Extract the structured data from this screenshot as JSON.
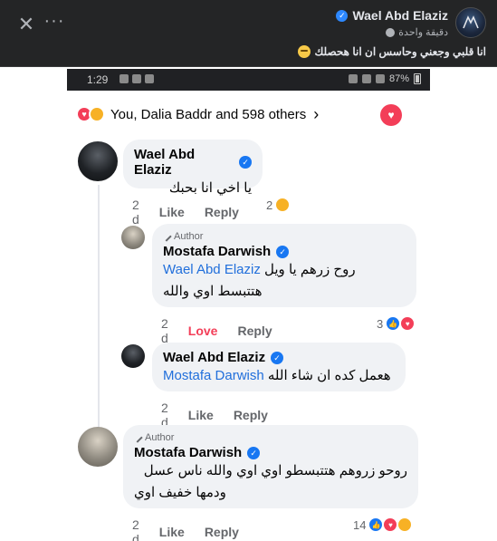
{
  "post": {
    "author": "Wael Abd Elaziz",
    "time": "دقيقة واحدة",
    "caption": "انا قلبي وجعني وحاسس ان انا هحصلك"
  },
  "screenshot": {
    "status_time": "1:29",
    "battery": "87%",
    "reactions_summary": "You, Dalia Baddr and 598 others"
  },
  "comments": [
    {
      "name": "Wael Abd Elaziz",
      "lines": [
        "يا اخي انا بحبك"
      ],
      "time": "2 d",
      "like": "Like",
      "reply": "Reply",
      "reaction_count": "2"
    },
    {
      "author_tag": "Author",
      "name": "Mostafa Darwish",
      "mention": "Wael Abd Elaziz",
      "line1_text": "روح زرهم يا ويل",
      "line2": "هتتبسط اوي والله",
      "time": "2 d",
      "like": "Love",
      "reply": "Reply",
      "reaction_count": "3"
    },
    {
      "name": "Wael Abd Elaziz",
      "mention": "Mostafa Darwish",
      "line1_text": "هعمل كده ان شاء الله",
      "time": "2 d",
      "like": "Like",
      "reply": "Reply"
    },
    {
      "author_tag": "Author",
      "name": "Mostafa Darwish",
      "lines": [
        "روحو زروهم هتتبسطو اوي اوي والله ناس عسل",
        "ودمها خفيف اوي"
      ],
      "time": "2 d",
      "like": "Like",
      "reply": "Reply",
      "reaction_count": "14"
    }
  ],
  "colors": {
    "accent": "#1877f2",
    "love": "#f33e58",
    "header_bg": "#242526"
  }
}
